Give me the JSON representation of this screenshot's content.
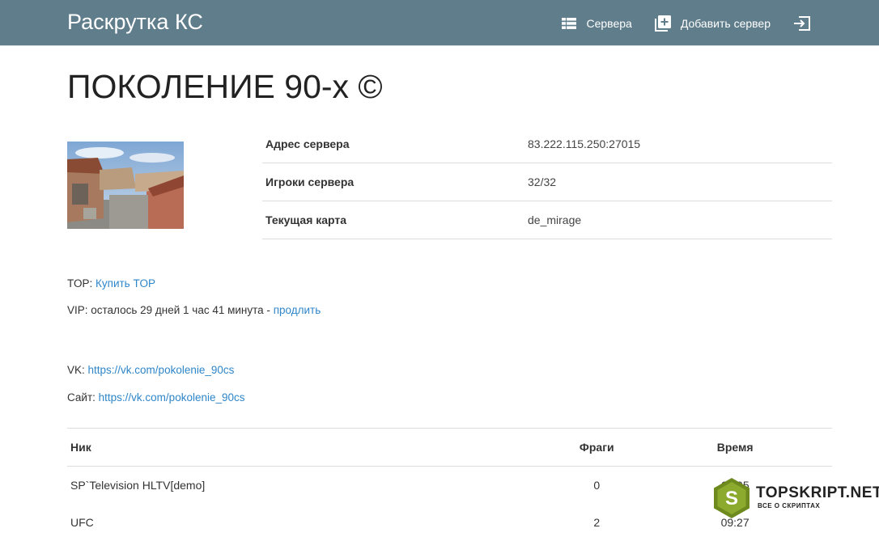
{
  "navbar": {
    "brand": "Раскрутка КС",
    "servers_label": "Сервера",
    "add_server_label": "Добавить сервер",
    "bg_color": "#607d8b"
  },
  "server": {
    "title": "ПОКОЛЕНИЕ 90-х ©",
    "info": [
      {
        "key": "Адрес сервера",
        "value": "83.222.115.250:27015"
      },
      {
        "key": "Игроки сервера",
        "value": "32/32"
      },
      {
        "key": "Текущая карта",
        "value": "de_mirage"
      }
    ]
  },
  "meta": {
    "top_label": "TOP:",
    "top_link": "Купить TOP",
    "vip_text": "VIP: осталось 29 дней 1 час 41 минута -",
    "vip_link": "продлить",
    "vk_label": "VK:",
    "vk_link": "https://vk.com/pokolenie_90cs",
    "site_label": "Сайт:",
    "site_link": "https://vk.com/pokolenie_90cs",
    "link_color": "#2f86c9"
  },
  "players": {
    "headers": {
      "nick": "Ник",
      "frags": "Фраги",
      "time": "Время"
    },
    "rows": [
      {
        "nick": "SP`Television HLTV[demo]",
        "frags": "0",
        "time": "16:05"
      },
      {
        "nick": "UFC",
        "frags": "2",
        "time": "09:27"
      }
    ]
  },
  "watermark": {
    "title": "TOPSKRIPT.NET",
    "subtitle": "ВСЕ О СКРИПТАХ",
    "letter": "S"
  }
}
